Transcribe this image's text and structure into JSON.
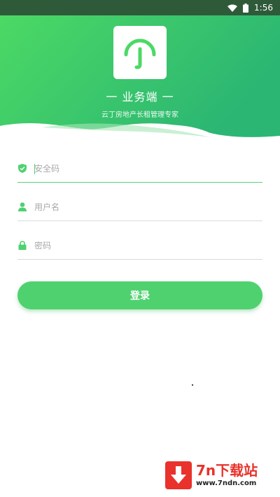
{
  "status_bar": {
    "time": "1:56",
    "wifi_icon": "wifi-icon",
    "battery_icon": "battery-icon"
  },
  "header": {
    "app_name": "一 业务端 一",
    "tagline": "云丁房地产长租管理专家",
    "logo_icon": "umbrella-hook-logo",
    "gradient_start": "#4cd964",
    "gradient_end": "#2bb673"
  },
  "form": {
    "security_code": {
      "placeholder": "安全码",
      "value": "",
      "icon": "shield-check-icon"
    },
    "username": {
      "placeholder": "用户名",
      "value": "",
      "icon": "user-icon"
    },
    "password": {
      "placeholder": "密码",
      "value": "",
      "icon": "lock-icon"
    },
    "accent_color": "#5bd17d"
  },
  "login_button": {
    "label": "登录",
    "color": "#4fd16f"
  },
  "watermark": {
    "title": "7n下载站",
    "url": "www.7ndn.com",
    "color": "#e8322b"
  }
}
